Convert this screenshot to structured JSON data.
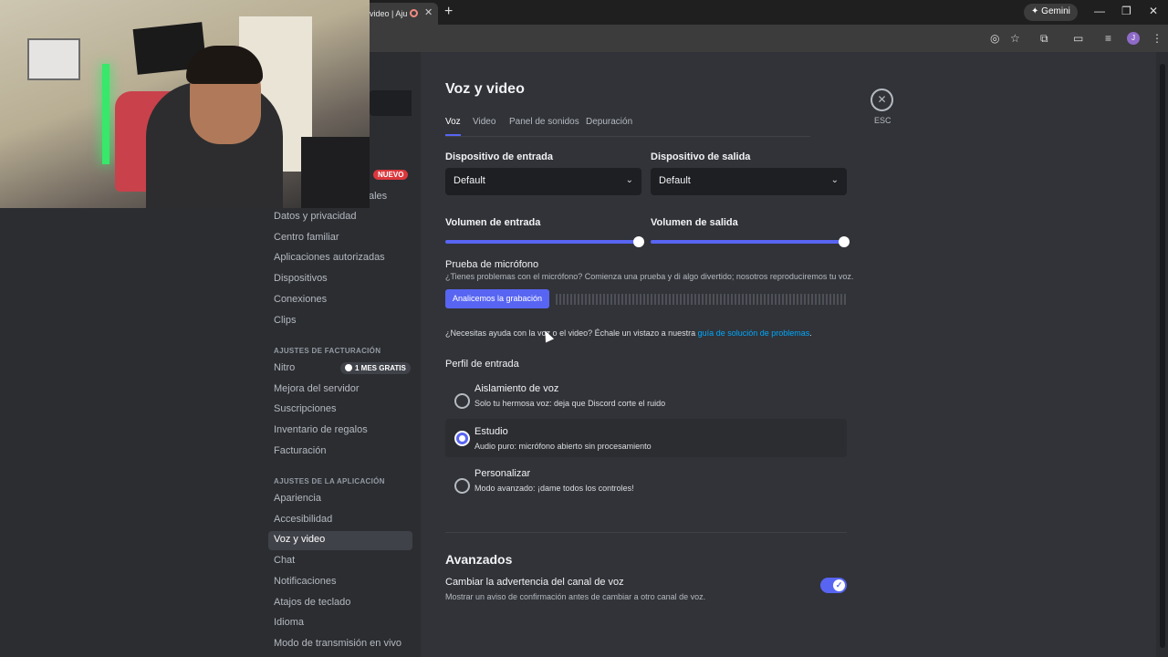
{
  "browser": {
    "tab_title": "video | Aju",
    "tab_close": "✕",
    "new_tab": "+",
    "gemini_label": "Gemini",
    "gemini_icon": "✦",
    "window_minimize": "—",
    "window_restore": "❐",
    "window_close": "✕",
    "profile_initial": "J"
  },
  "sidebar": {
    "new_badge": "NUEVO",
    "partial_item": "ales",
    "items_top": [
      "Datos y privacidad",
      "Centro familiar",
      "Aplicaciones autorizadas",
      "Dispositivos",
      "Conexiones",
      "Clips"
    ],
    "billing_header": "AJUSTES DE FACTURACIÓN",
    "billing_items": [
      "Nitro",
      "Mejora del servidor",
      "Suscripciones",
      "Inventario de regalos",
      "Facturación"
    ],
    "nitro_badge": "1 MES GRATIS",
    "app_header": "AJUSTES DE LA APLICACIÓN",
    "app_items": [
      "Apariencia",
      "Accesibilidad",
      "Voz y video",
      "Chat",
      "Notificaciones",
      "Atajos de teclado",
      "Idioma",
      "Modo de transmisión en vivo"
    ]
  },
  "main": {
    "title": "Voz y video",
    "tabs": [
      "Voz",
      "Video",
      "Panel de sonidos",
      "Depuración"
    ],
    "esc_icon": "✕",
    "esc_label": "ESC",
    "input_device_label": "Dispositivo de entrada",
    "input_device_value": "Default",
    "output_device_label": "Dispositivo de salida",
    "output_device_value": "Default",
    "input_volume_label": "Volumen de entrada",
    "input_volume_level": 1.0,
    "output_volume_label": "Volumen de salida",
    "output_volume_level": 1.0,
    "mic_test_title": "Prueba de micrófono",
    "mic_test_desc": "¿Tienes problemas con el micrófono? Comienza una prueba y di algo divertido; nosotros reproduciremos tu voz.",
    "mic_test_button": "Analicemos la grabación",
    "help_text": "¿Necesitas ayuda con la voz o el video? Échale un vistazo a nuestra ",
    "help_link": "guía de solución de problemas",
    "help_end": ".",
    "input_profile_title": "Perfil de entrada",
    "profiles": [
      {
        "title": "Aislamiento de voz",
        "desc": "Solo tu hermosa voz: deja que Discord corte el ruido"
      },
      {
        "title": "Estudio",
        "desc": "Audio puro: micrófono abierto sin procesamiento"
      },
      {
        "title": "Personalizar",
        "desc": "Modo avanzado: ¡dame todos los controles!"
      }
    ],
    "selected_profile": "Estudio",
    "advanced_title": "Avanzados",
    "advanced_toggle_title": "Cambiar la advertencia del canal de voz",
    "advanced_toggle_desc": "Mostrar un aviso de confirmación antes de cambiar a otro canal de voz.",
    "advanced_toggle_on": true,
    "toggle_check": "✓",
    "chevron": "⌄"
  },
  "colors": {
    "accent": "#5865f2",
    "background": "#313338",
    "sidebar": "#2b2d31",
    "badge_red": "#da373c",
    "link": "#00a8fc"
  }
}
